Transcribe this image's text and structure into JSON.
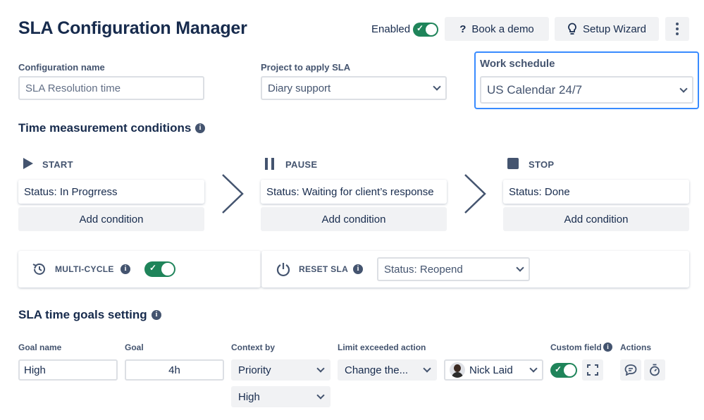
{
  "header": {
    "title": "SLA Configuration Manager",
    "enabled_label": "Enabled",
    "book_demo_label": "Book a demo",
    "setup_wizard_label": "Setup Wizard"
  },
  "config": {
    "name_label": "Configuration name",
    "name_placeholder": "SLA Resolution time",
    "project_label": "Project to apply SLA",
    "project_value": "Diary support",
    "schedule_label": "Work schedule",
    "schedule_value": "US Calendar 24/7"
  },
  "time_conditions": {
    "title": "Time measurement conditions",
    "start": {
      "label": "START",
      "condition": "Status: In Progrress",
      "add": "Add condition"
    },
    "pause": {
      "label": "PAUSE",
      "condition": "Status: Waiting for client’s response",
      "add": "Add condition"
    },
    "stop": {
      "label": "STOP",
      "condition": "Status: Done",
      "add": "Add condition"
    },
    "multicycle_label": "MULTI-CYCLE",
    "reset_label": "RESET SLA",
    "reset_value": "Status: Reopend"
  },
  "goals": {
    "title": "SLA time goals setting",
    "columns": {
      "goal_name": "Goal name",
      "goal": "Goal",
      "context_by": "Context by",
      "limit_action": "Limit exceeded action",
      "custom_field": "Custom field",
      "actions": "Actions"
    },
    "row": {
      "goal_name": "High",
      "goal": "4h",
      "context_primary": "Priority",
      "context_secondary": "High",
      "limit_action": "Change the...",
      "assignee": "Nick Laid"
    }
  },
  "colors": {
    "accent_green": "#1f845a",
    "focus_blue": "#388bff",
    "text_primary": "#172b4d"
  }
}
